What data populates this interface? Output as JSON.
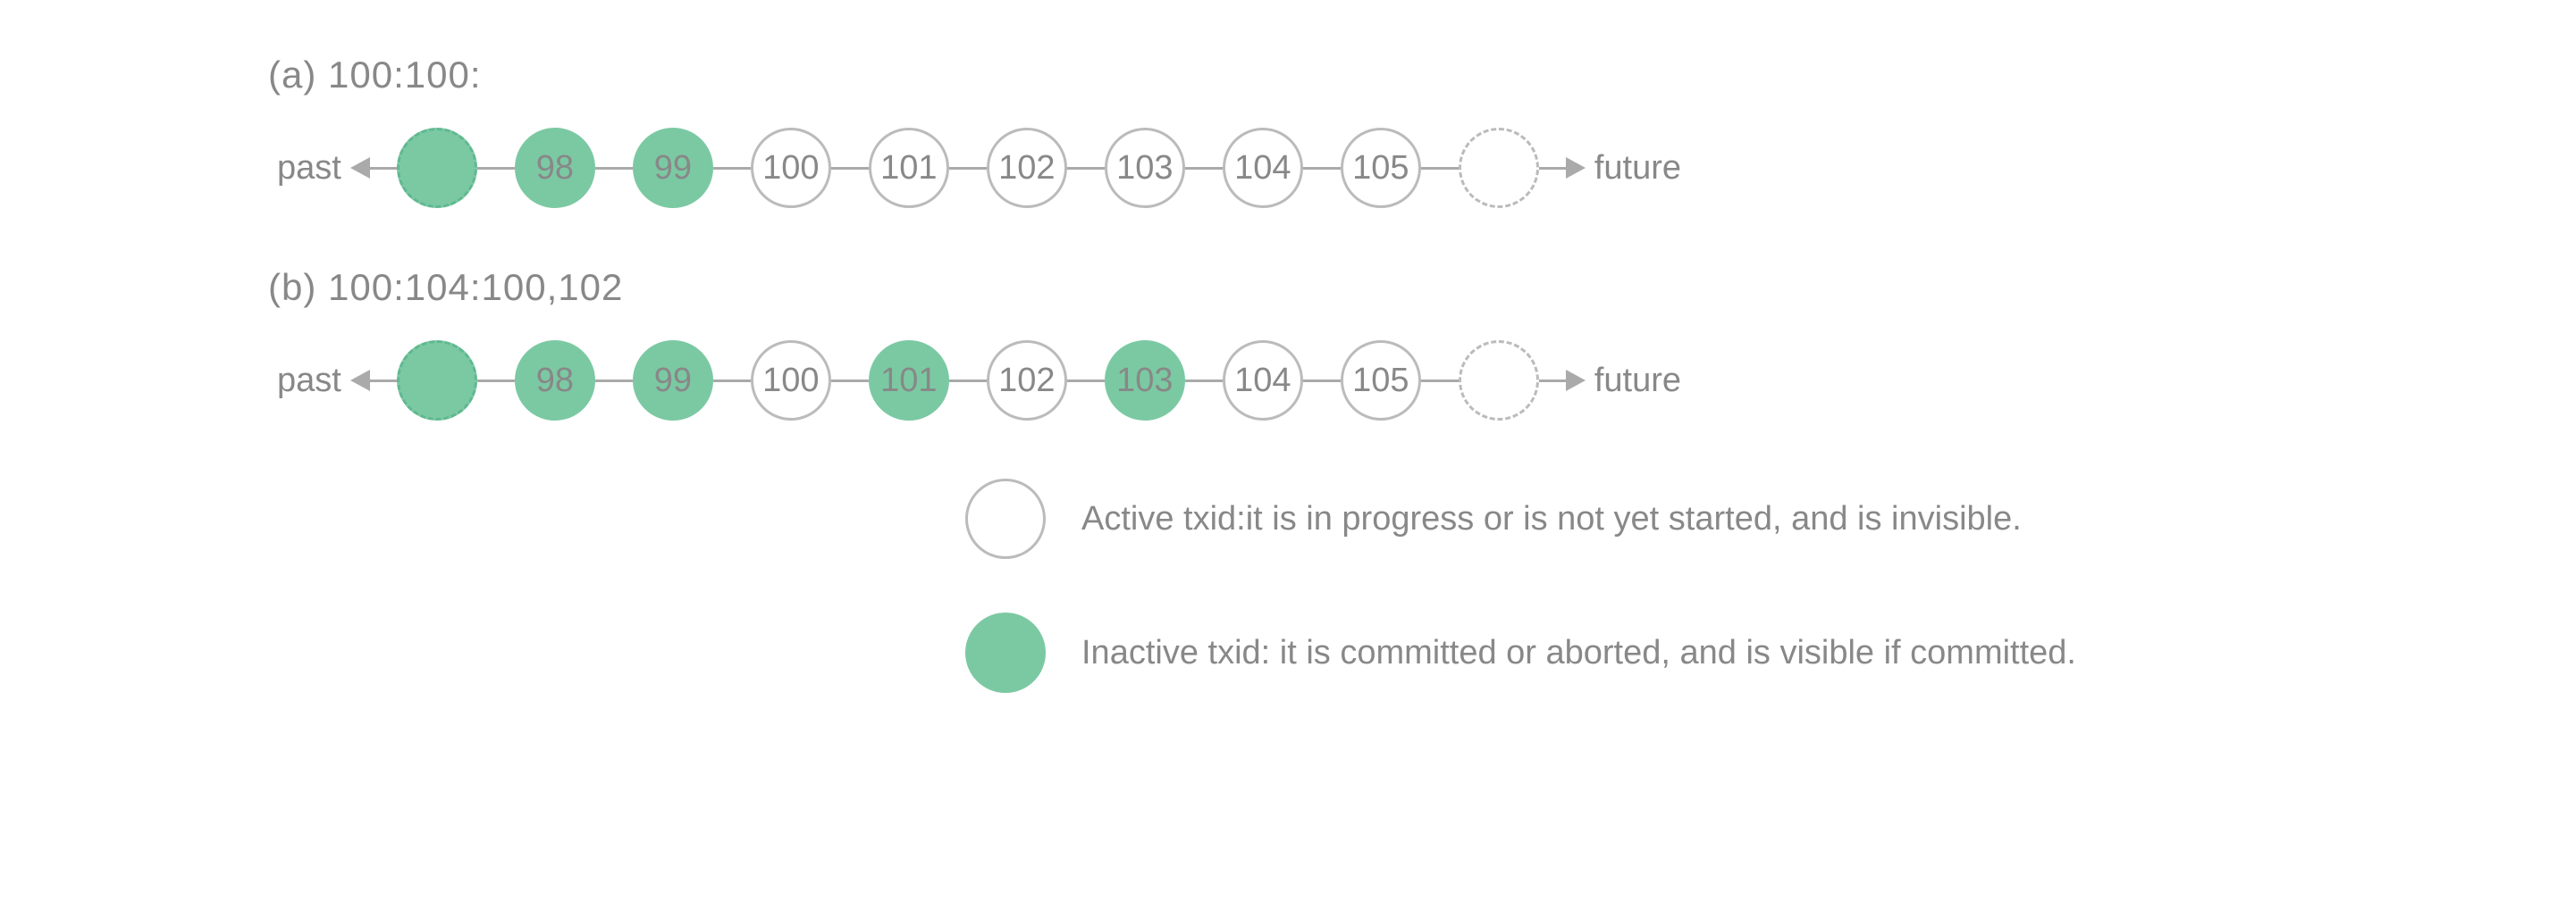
{
  "sections": {
    "a": {
      "label": "(a) 100:100:",
      "past": "past",
      "future": "future"
    },
    "b": {
      "label": "(b) 100:104:100,102",
      "past": "past",
      "future": "future"
    }
  },
  "nodes_a": {
    "n1": "",
    "n2": "98",
    "n3": "99",
    "n4": "100",
    "n5": "101",
    "n6": "102",
    "n7": "103",
    "n8": "104",
    "n9": "105",
    "n10": ""
  },
  "nodes_b": {
    "n1": "",
    "n2": "98",
    "n3": "99",
    "n4": "100",
    "n5": "101",
    "n6": "102",
    "n7": "103",
    "n8": "104",
    "n9": "105",
    "n10": ""
  },
  "legend": {
    "active": "Active txid:it is in progress or is not yet started,  and is invisible.",
    "inactive": "Inactive txid: it is committed or aborted, and is visible if committed."
  },
  "colors": {
    "inactive_fill": "#7bc9a3",
    "stroke": "#bbb",
    "text": "#888"
  },
  "chart_data": [
    {
      "type": "timeline",
      "label": "(a) 100:100:",
      "snapshot": {
        "xmin": 100,
        "xmax": 100,
        "xip_list": []
      },
      "nodes": [
        {
          "txid": null,
          "state": "inactive",
          "dashed": true
        },
        {
          "txid": 98,
          "state": "inactive"
        },
        {
          "txid": 99,
          "state": "inactive"
        },
        {
          "txid": 100,
          "state": "active"
        },
        {
          "txid": 101,
          "state": "active"
        },
        {
          "txid": 102,
          "state": "active"
        },
        {
          "txid": 103,
          "state": "active"
        },
        {
          "txid": 104,
          "state": "active"
        },
        {
          "txid": 105,
          "state": "active"
        },
        {
          "txid": null,
          "state": "future",
          "dashed": true
        }
      ]
    },
    {
      "type": "timeline",
      "label": "(b) 100:104:100,102",
      "snapshot": {
        "xmin": 100,
        "xmax": 104,
        "xip_list": [
          100,
          102
        ]
      },
      "nodes": [
        {
          "txid": null,
          "state": "inactive",
          "dashed": true
        },
        {
          "txid": 98,
          "state": "inactive"
        },
        {
          "txid": 99,
          "state": "inactive"
        },
        {
          "txid": 100,
          "state": "active"
        },
        {
          "txid": 101,
          "state": "inactive"
        },
        {
          "txid": 102,
          "state": "active"
        },
        {
          "txid": 103,
          "state": "inactive"
        },
        {
          "txid": 104,
          "state": "active"
        },
        {
          "txid": 105,
          "state": "active"
        },
        {
          "txid": null,
          "state": "future",
          "dashed": true
        }
      ]
    }
  ]
}
